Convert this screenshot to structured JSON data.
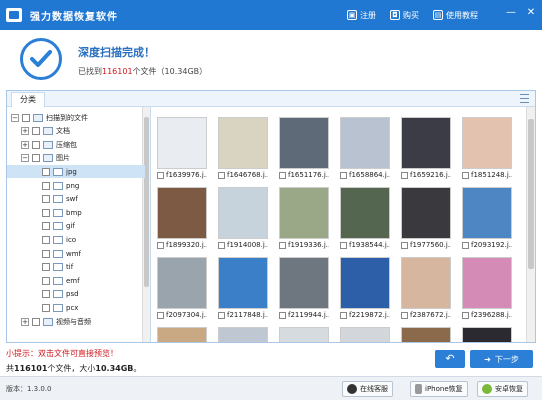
{
  "app": {
    "title": "强力数据恢复软件"
  },
  "titlebar": {
    "links": [
      {
        "label": "注册",
        "icon": "register-icon"
      },
      {
        "label": "购买",
        "icon": "cart-icon"
      },
      {
        "label": "使用教程",
        "icon": "tutorial-icon"
      }
    ],
    "window_buttons": [
      "minimize-icon",
      "close-icon"
    ]
  },
  "header": {
    "title": "深度扫描完成！",
    "found_prefix": "已找到",
    "found_count": "116101",
    "found_suffix": "个文件（10.34GB）"
  },
  "tabs": [
    {
      "label": "分类"
    }
  ],
  "tree": [
    {
      "label": "扫描到的文件",
      "indent": 0,
      "expander": "−",
      "icon": "folder"
    },
    {
      "label": "文档",
      "indent": 1,
      "expander": "+",
      "icon": "folder"
    },
    {
      "label": "压缩包",
      "indent": 1,
      "expander": "+",
      "icon": "folder"
    },
    {
      "label": "图片",
      "indent": 1,
      "expander": "−",
      "icon": "folder"
    },
    {
      "label": "jpg",
      "indent": 2,
      "expander": "",
      "icon": "doc",
      "selected": true
    },
    {
      "label": "png",
      "indent": 2,
      "expander": "",
      "icon": "doc"
    },
    {
      "label": "swf",
      "indent": 2,
      "expander": "",
      "icon": "doc"
    },
    {
      "label": "bmp",
      "indent": 2,
      "expander": "",
      "icon": "doc"
    },
    {
      "label": "gif",
      "indent": 2,
      "expander": "",
      "icon": "doc"
    },
    {
      "label": "ico",
      "indent": 2,
      "expander": "",
      "icon": "doc"
    },
    {
      "label": "wmf",
      "indent": 2,
      "expander": "",
      "icon": "doc"
    },
    {
      "label": "tif",
      "indent": 2,
      "expander": "",
      "icon": "doc"
    },
    {
      "label": "emf",
      "indent": 2,
      "expander": "",
      "icon": "doc"
    },
    {
      "label": "psd",
      "indent": 2,
      "expander": "",
      "icon": "doc"
    },
    {
      "label": "pcx",
      "indent": 2,
      "expander": "",
      "icon": "doc"
    },
    {
      "label": "视频与音频",
      "indent": 1,
      "expander": "+",
      "icon": "folder"
    }
  ],
  "files": [
    {
      "name": "f1639976.j...",
      "color": "#e9edf2"
    },
    {
      "name": "f1646768.j...",
      "color": "#d9d3c2"
    },
    {
      "name": "f1651176.j...",
      "color": "#5f6a78"
    },
    {
      "name": "f1658864.j...",
      "color": "#b8c2d0"
    },
    {
      "name": "f1659216.j...",
      "color": "#3c3c46"
    },
    {
      "name": "f1851248.j...",
      "color": "#e4c2b0"
    },
    {
      "name": "f1899320.j...",
      "color": "#7c5a44"
    },
    {
      "name": "f1914008.j...",
      "color": "#c6d2dc"
    },
    {
      "name": "f1919336.j...",
      "color": "#9aa888"
    },
    {
      "name": "f1938544.j...",
      "color": "#556650"
    },
    {
      "name": "f1977560.j...",
      "color": "#3a3a3e"
    },
    {
      "name": "f2093192.j...",
      "color": "#4d86c2"
    },
    {
      "name": "f2097304.j...",
      "color": "#9aa4ac"
    },
    {
      "name": "f2117848.j...",
      "color": "#3a7fc8"
    },
    {
      "name": "f2119944.j...",
      "color": "#6e7680"
    },
    {
      "name": "f2219872.j...",
      "color": "#2c5fa8"
    },
    {
      "name": "f2387672.j...",
      "color": "#d7b6a0"
    },
    {
      "name": "f2396288.j...",
      "color": "#d48bb6"
    },
    {
      "name": "",
      "color": "#c9a884"
    },
    {
      "name": "",
      "color": "#bfc8d2"
    },
    {
      "name": "",
      "color": "#d6dbe0"
    },
    {
      "name": "",
      "color": "#d3d6da"
    },
    {
      "name": "",
      "color": "#8a6a4a"
    },
    {
      "name": "",
      "color": "#2a2a30"
    }
  ],
  "tip": "小提示：双击文件可直接预览！",
  "summary": {
    "prefix": "共",
    "count": "116101",
    "middle": "个文件，大小",
    "size": "10.34GB",
    "suffix": "。"
  },
  "buttons": {
    "back": "↶",
    "next": "下一步"
  },
  "status": {
    "version": "版本：1.3.0.0",
    "online_service": "在线客服",
    "iphone_recover": "iPhone恢复",
    "android_recover": "安卓恢复"
  },
  "colors": {
    "accent": "#2178d2",
    "warn": "#d0161b"
  }
}
